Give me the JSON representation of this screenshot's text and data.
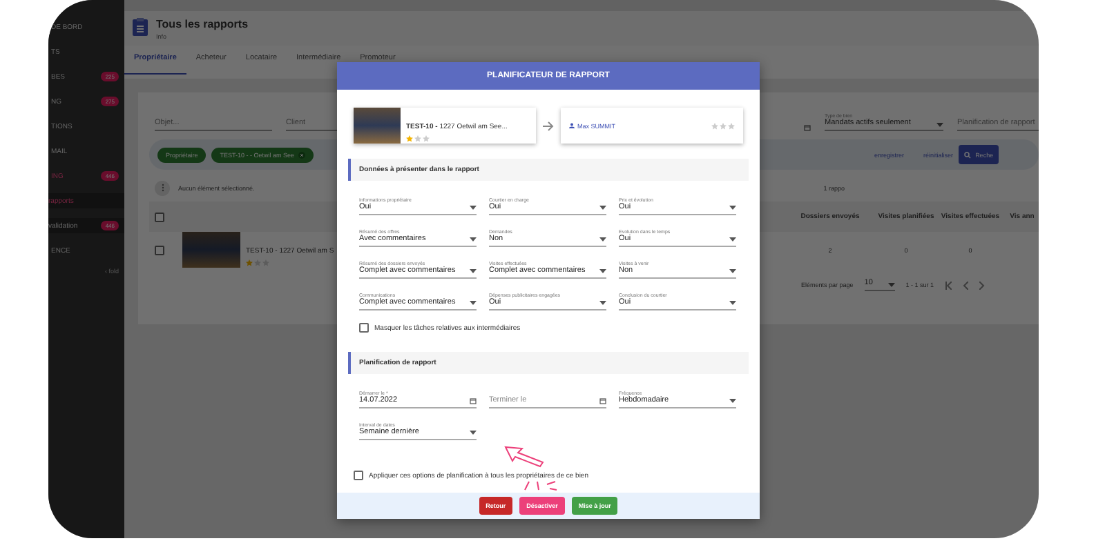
{
  "sidebar": {
    "items": [
      {
        "label": "DE BORD",
        "kind": "section",
        "active": false
      },
      {
        "label": "TS",
        "kind": "section",
        "active": false
      },
      {
        "label": "BES",
        "kind": "section",
        "badge": "225",
        "active": false
      },
      {
        "label": "NG",
        "kind": "section",
        "badge": "275",
        "active": false
      },
      {
        "label": "TIONS",
        "kind": "section",
        "active": false
      },
      {
        "label": "MAIL",
        "kind": "section",
        "active": false
      },
      {
        "label": "ING",
        "kind": "section",
        "badge": "446",
        "active": true
      },
      {
        "label": "rapports",
        "kind": "sub",
        "active": true
      },
      {
        "label": "validation",
        "kind": "sub",
        "badge": "446",
        "active": false
      },
      {
        "label": "ENCE",
        "kind": "section",
        "active": false
      }
    ],
    "fold": "‹ fold"
  },
  "header": {
    "title": "Tous les rapports",
    "subtitle": "Info"
  },
  "tabs": [
    {
      "label": "Propriétaire",
      "selected": true
    },
    {
      "label": "Acheteur",
      "selected": false
    },
    {
      "label": "Locataire",
      "selected": false
    },
    {
      "label": "Intermédiaire",
      "selected": false
    },
    {
      "label": "Promoteur",
      "selected": false
    }
  ],
  "filters": {
    "object": {
      "placeholder": "Objet..."
    },
    "client": {
      "placeholder": "Client"
    },
    "property_type": {
      "label": "Type de bien",
      "value": "Mandats actifs seulement"
    },
    "schedule": {
      "placeholder": "Planification de rapport"
    }
  },
  "chips": [
    {
      "label": "Propriétaire",
      "removable": false
    },
    {
      "label": "TEST-10 - - Oetwil am See",
      "removable": true
    }
  ],
  "actions": {
    "save": "enregistrer",
    "reset": "réinitialiser",
    "search": "Reche"
  },
  "selection": "Aucun élément sélectionné.",
  "count": "1 rappo",
  "table": {
    "select_all": {
      "checked": false
    },
    "columns": [
      "Dossiers envoyés",
      "Visites planifiées",
      "Visites effectuées",
      "Vis ann"
    ],
    "rows": [
      {
        "code": "TEST-10 -",
        "address": "1227 Oetwil am S",
        "stars": 1,
        "checked": false,
        "cells": [
          "2",
          "0",
          "0"
        ]
      }
    ]
  },
  "paginator": {
    "label": "Eléments par page",
    "page_size": "10",
    "range": "1 - 1 sur 1"
  },
  "modal": {
    "title": "PLANIFICATEUR DE RAPPORT",
    "property": {
      "code": "TEST-10 -",
      "address": "1227 Oetwil am See...",
      "stars": 1
    },
    "contact": {
      "name": "Max SUMMIT",
      "stars": 0
    },
    "sections": [
      {
        "title": "Données à présenter dans le rapport",
        "fields": [
          {
            "kind": "select",
            "label": "Informations propriétaire",
            "value": "Oui"
          },
          {
            "kind": "select",
            "label": "Courtier en charge",
            "value": "Oui"
          },
          {
            "kind": "select",
            "label": "Prix et évolution",
            "value": "Oui"
          },
          {
            "kind": "select",
            "label": "Résumé des offres",
            "value": "Avec commentaires"
          },
          {
            "kind": "select",
            "label": "Demandes",
            "value": "Non"
          },
          {
            "kind": "select",
            "label": "Evolution dans le temps",
            "value": "Oui"
          },
          {
            "kind": "select",
            "label": "Résumé des dossiers envoyés",
            "value": "Complet avec commentaires"
          },
          {
            "kind": "select",
            "label": "Visites effectuées",
            "value": "Complet avec commentaires"
          },
          {
            "kind": "select",
            "label": "Visites à venir",
            "value": "Non"
          },
          {
            "kind": "select",
            "label": "Communications",
            "value": "Complet avec commentaires"
          },
          {
            "kind": "select",
            "label": "Dépenses publicitaires engagées",
            "value": "Oui"
          },
          {
            "kind": "select",
            "label": "Conclusion du courtier",
            "value": "Oui"
          }
        ],
        "checkbox": {
          "label": "Masquer les tâches relatives aux intermédiaires",
          "checked": false
        }
      },
      {
        "title": "Planification de rapport",
        "fields": [
          {
            "kind": "date",
            "label": "Démarrer le *",
            "value": "14.07.2022"
          },
          {
            "kind": "date",
            "placeholder": "Terminer le"
          },
          {
            "kind": "select",
            "label": "Fréquence",
            "value": "Hebdomadaire"
          },
          {
            "kind": "select",
            "label": "Interval de dates",
            "value": "Semaine dernière"
          }
        ]
      }
    ],
    "apply": {
      "label": "Appliquer ces options de planification à tous les propriétaires de ce bien",
      "checked": false
    },
    "buttons": [
      {
        "label": "Retour",
        "kind": "back"
      },
      {
        "label": "Désactiver",
        "kind": "deactivate"
      },
      {
        "label": "Mise à jour",
        "kind": "update"
      }
    ]
  }
}
